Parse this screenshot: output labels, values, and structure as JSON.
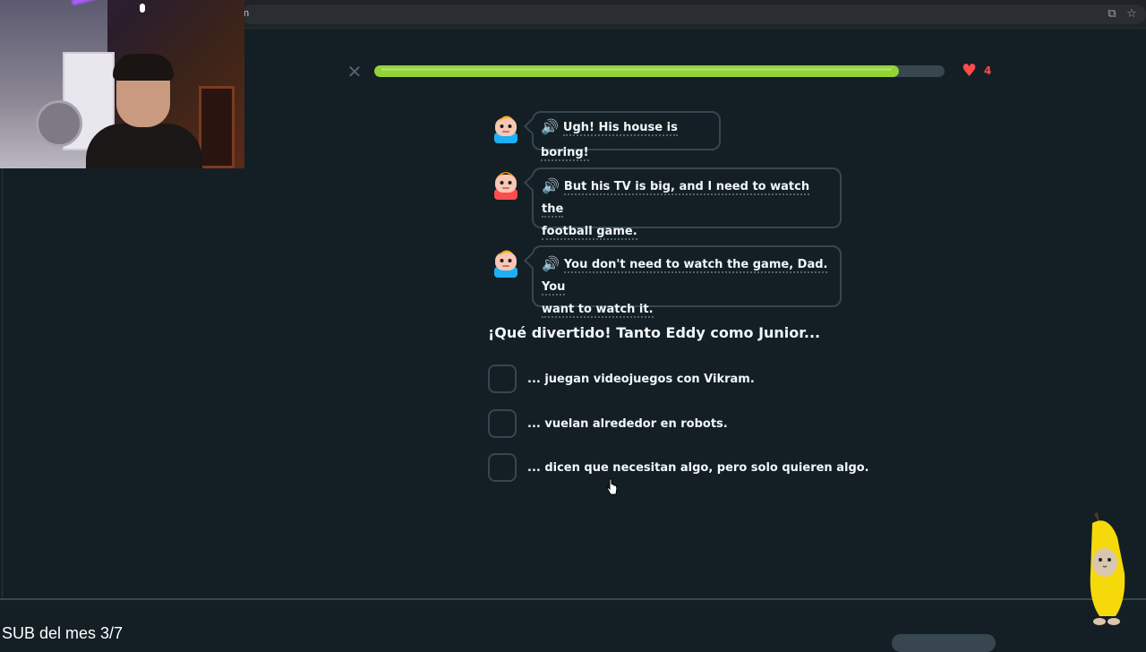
{
  "browser": {
    "url_fragment": "n",
    "icons": [
      "extension-icon",
      "bookmark-star-icon"
    ]
  },
  "webcam": {
    "description_icon": "webcam-overlay"
  },
  "lesson": {
    "progress_percent": 92,
    "hearts": "4",
    "accent_color": "#93d333",
    "heart_color": "#ff4b4b"
  },
  "chat": [
    {
      "speaker": "Eddy",
      "text": "Ugh! His house is boring!"
    },
    {
      "speaker": "Junior",
      "text_line1": "But his TV is big, and I need to watch the",
      "text_line2": "football game."
    },
    {
      "speaker": "Eddy",
      "text_line1": "You don't need to watch the game, Dad. You",
      "text_line2": "want to watch it."
    }
  ],
  "question": {
    "prompt": "¡Qué divertido! Tanto Eddy como Junior..."
  },
  "options": [
    {
      "label": "... juegan videojuegos con Vikram."
    },
    {
      "label": "... vuelan alrededor en robots."
    },
    {
      "label": "... dicen que necesitan algo, pero solo quieren algo."
    }
  ],
  "overlay": {
    "sub_text": "SUB del mes 3/7"
  }
}
